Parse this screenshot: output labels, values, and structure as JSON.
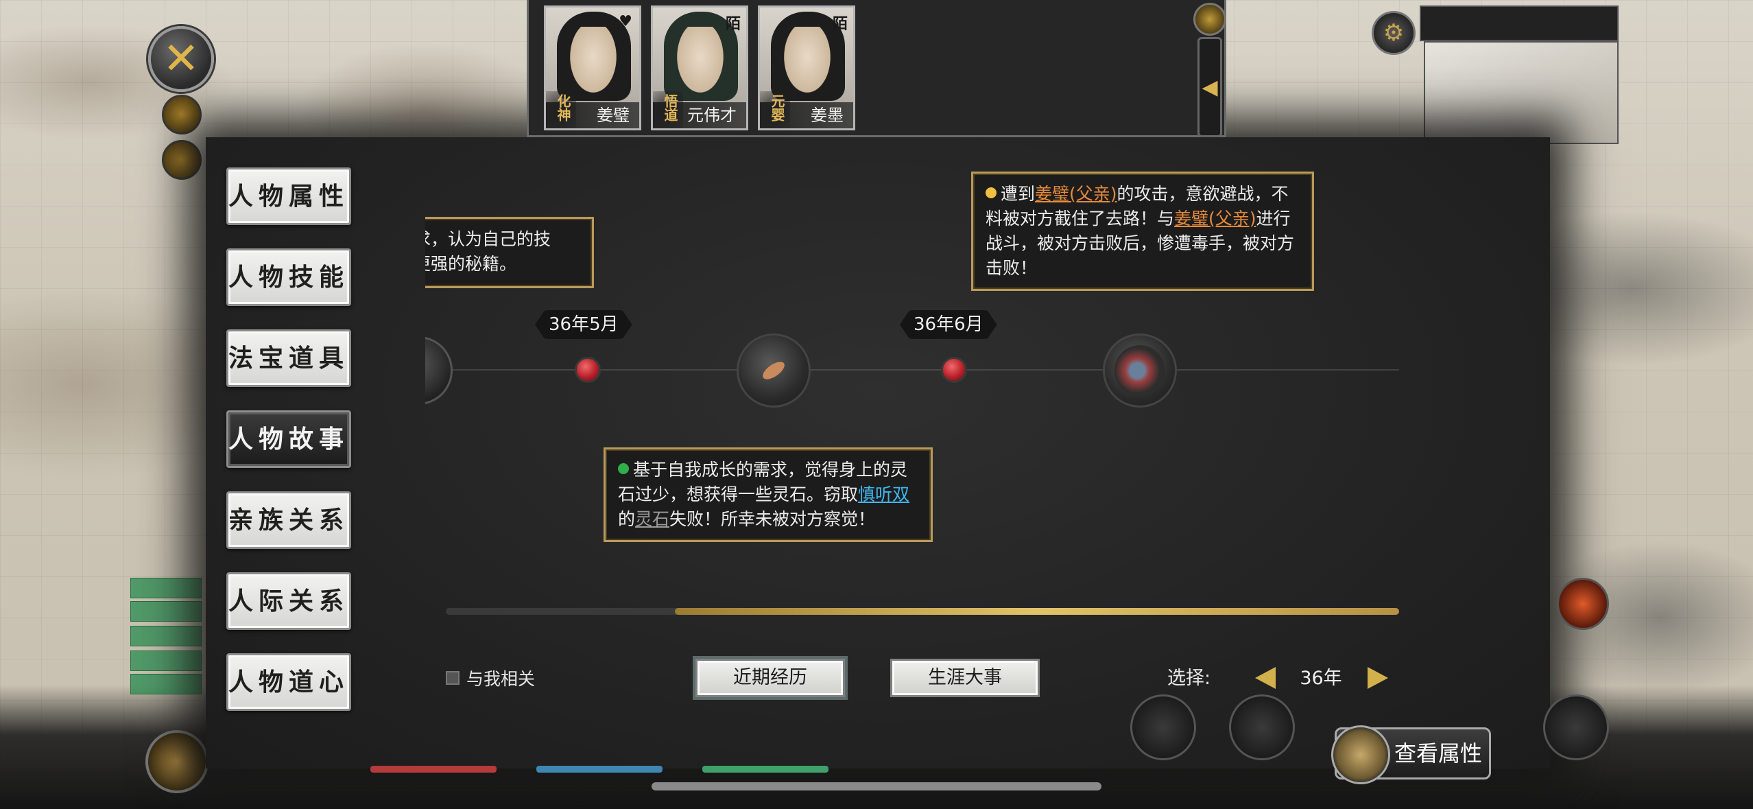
{
  "close_button": {
    "label": "✕"
  },
  "characters": [
    {
      "name": "姜璧",
      "realm": "化神",
      "tag": "♥",
      "hair": "#1a1a1a"
    },
    {
      "name": "元伟才",
      "realm": "悟道",
      "tag": "陌",
      "hair": "#2a3a2a"
    },
    {
      "name": "姜墨",
      "realm": "元婴",
      "tag": "陌",
      "hair": "#151515"
    }
  ],
  "menu": [
    {
      "label": "人物属性",
      "active": false
    },
    {
      "label": "人物技能",
      "active": false
    },
    {
      "label": "法宝道具",
      "active": false
    },
    {
      "label": "人物故事",
      "active": true
    },
    {
      "label": "亲族关系",
      "active": false
    },
    {
      "label": "人际关系",
      "active": false
    },
    {
      "label": "人物道心",
      "active": false
    }
  ],
  "timeline": {
    "dates": [
      "36年5月",
      "36年6月"
    ],
    "events": [
      {
        "bullet_color": "#2fae4a",
        "segments": [
          {
            "text": "基于自我成长的需求，觉得身上的灵石过少，想获得一些灵石。窃取",
            "style": "normal"
          },
          {
            "text": "慎听双",
            "style": "blue"
          },
          {
            "text": "的",
            "style": "normal"
          },
          {
            "text": "灵石",
            "style": "gray"
          },
          {
            "text": "失败！所幸未被对方察觉！",
            "style": "normal"
          }
        ]
      },
      {
        "bullet_color": "#f0c040",
        "segments": [
          {
            "text": "遭到",
            "style": "normal"
          },
          {
            "text": "姜璧(父亲)",
            "style": "orange"
          },
          {
            "text": "的攻击，意欲避战，不料被对方截住了去路！与",
            "style": "normal"
          },
          {
            "text": "姜璧(父亲)",
            "style": "orange"
          },
          {
            "text": "进行战斗，被对方击败后，惨遭毒手，被对方击败！",
            "style": "normal"
          }
        ]
      }
    ],
    "partial_card": {
      "line1": "求，认为自己的技",
      "line2": "更强的秘籍。"
    }
  },
  "progress": {
    "value": 0.76
  },
  "controls": {
    "related_to_me_label": "与我相关",
    "recent_label": "近期经历",
    "career_label": "生涯大事",
    "select_label": "选择:",
    "selected_year": "36年"
  },
  "view_attributes_label": "查看属性",
  "colors": {
    "accent_gold": "#d2b14c",
    "panel_bg": "#232323",
    "card_border": "#b89a5a"
  }
}
